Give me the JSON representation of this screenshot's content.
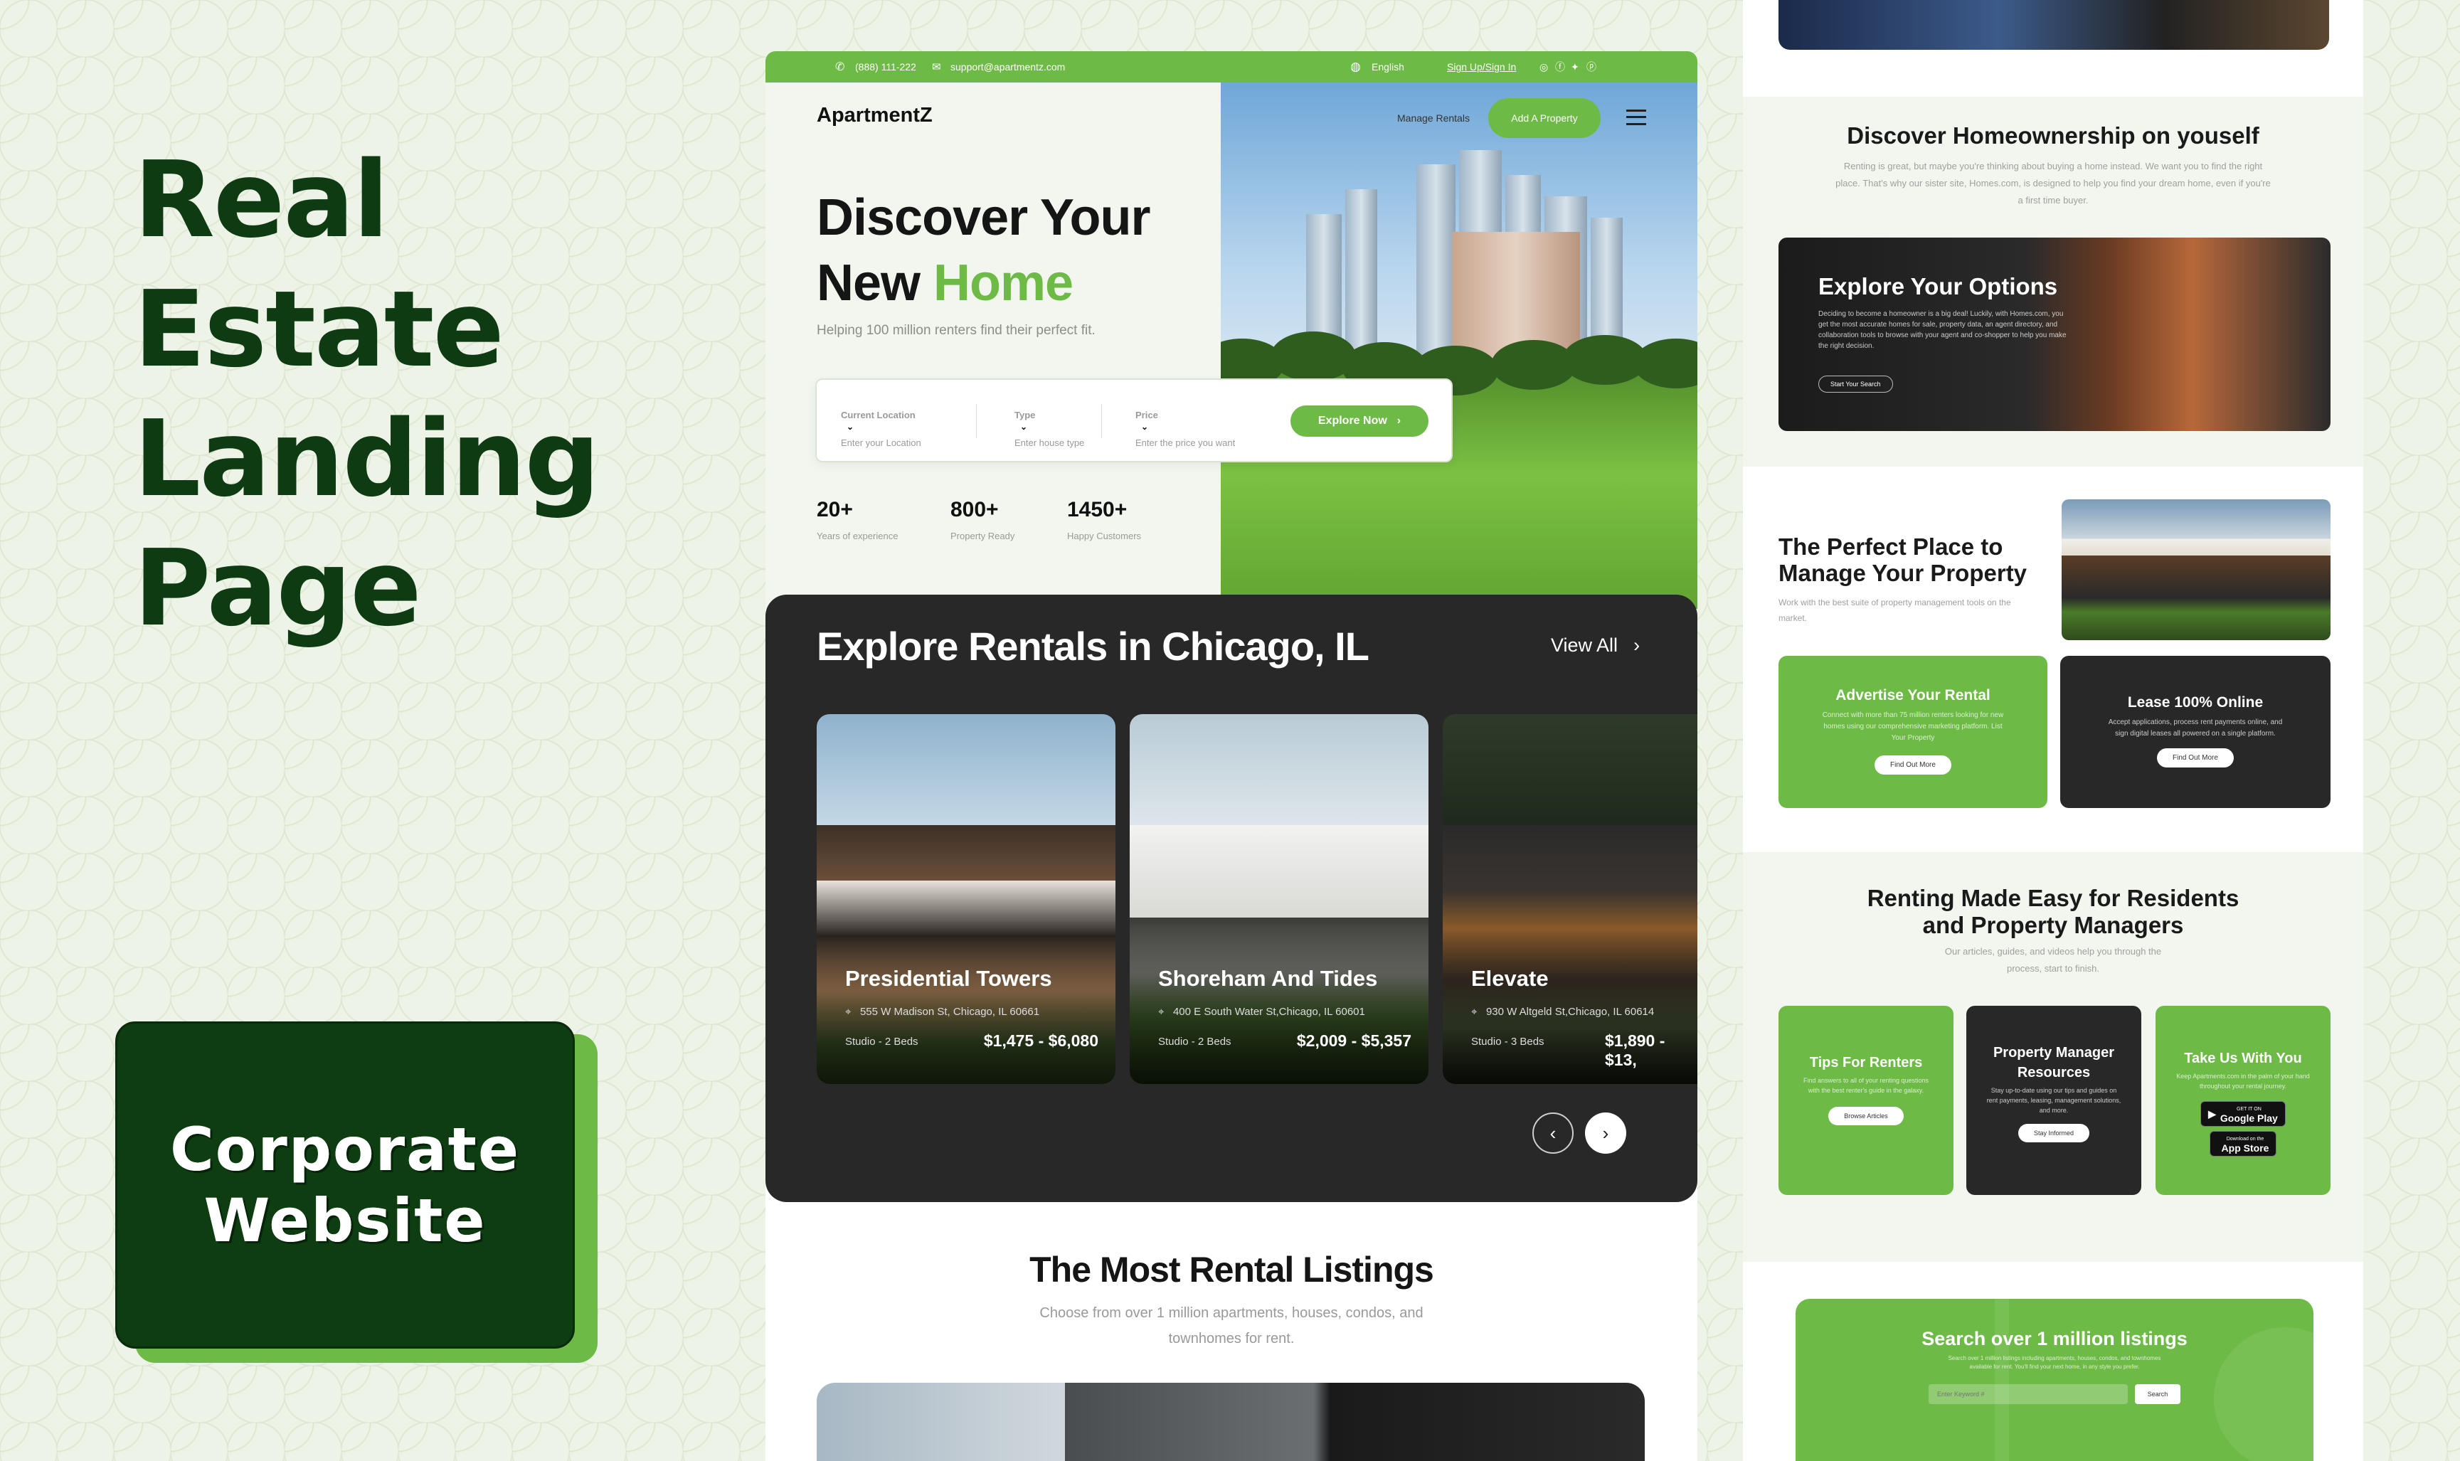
{
  "poster": {
    "title_lines": [
      "Real",
      "Estate",
      "Landing",
      "Page"
    ],
    "badge_lines": [
      "Corporate",
      "Website"
    ]
  },
  "topbar": {
    "phone": "(888) 111-222",
    "email": "support@apartmentz.com",
    "language": "English",
    "auth": "Sign Up/Sign In"
  },
  "nav": {
    "brand": "ApartmentZ",
    "manage": "Manage Rentals",
    "add": "Add A Property"
  },
  "hero": {
    "title_line1": "Discover Your",
    "title_line2_a": "New ",
    "title_line2_b": "Home",
    "subtitle": "Helping 100 million renters find their perfect fit.",
    "search": [
      {
        "label": "Current Location",
        "hint": "Enter your Location"
      },
      {
        "label": "Type",
        "hint": "Enter house type"
      },
      {
        "label": "Price",
        "hint": "Enter the price you want"
      }
    ],
    "cta": "Explore Now",
    "stats": [
      {
        "value": "20+",
        "label": "Years of experience"
      },
      {
        "value": "800+",
        "label": "Property Ready"
      },
      {
        "value": "1450+",
        "label": "Happy Customers"
      }
    ]
  },
  "rentals": {
    "title": "Explore Rentals in Chicago, IL",
    "view_all": "View All",
    "items": [
      {
        "name": "Presidential Towers",
        "address": "555 W Madison St, Chicago, IL 60661",
        "beds": "Studio - 2 Beds",
        "price": "$1,475 - $6,080"
      },
      {
        "name": "Shoreham And Tides",
        "address": "400 E South Water St,Chicago, IL 60601",
        "beds": "Studio - 2 Beds",
        "price": "$2,009 - $5,357"
      },
      {
        "name": "Elevate",
        "address": "930 W Altgeld St,Chicago, IL 60614",
        "beds": "Studio - 3 Beds",
        "price": "$1,890 - $13,"
      }
    ]
  },
  "listings": {
    "title": "The Most Rental Listings",
    "subtitle_line1": "Choose from over 1 million apartments, houses, condos, and",
    "subtitle_line2": "townhomes for rent."
  },
  "right": {
    "homeownership": {
      "title": "Discover Homeownership on youself",
      "text": "Renting is great, but maybe you're thinking about buying a home instead. We want you to find the right place. That's why our sister site, Homes.com, is designed to help you find your dream home, even if you're a first time buyer."
    },
    "options": {
      "title": "Explore Your Options",
      "text": "Deciding to become a homeowner is a big deal! Luckily, with Homes.com, you get the most accurate homes for sale, property data, an agent directory, and collaboration tools to browse with your agent and co-shopper to help you make the right decision.",
      "button": "Start Your Search"
    },
    "manage": {
      "title_line1": "The Perfect Place to",
      "title_line2": "Manage Your Property",
      "text": "Work with the best suite of property management tools on the market."
    },
    "advertise": {
      "title": "Advertise Your Rental",
      "text": "Connect with more than 75 million renters looking for new homes using our comprehensive marketing platform. List Your Property",
      "button": "Find Out More"
    },
    "lease": {
      "title": "Lease 100% Online",
      "text": "Accept applications, process rent payments online, and sign digital leases all powered on a single platform.",
      "button": "Find Out More"
    },
    "easy": {
      "title_line1": "Renting Made Easy for Residents",
      "title_line2": "and Property Managers",
      "text": "Our articles, guides, and videos help you through the process, start to finish."
    },
    "tiles": [
      {
        "title": "Tips For Renters",
        "text": "Find answers to all of your renting questions with the best renter's guide in the galaxy.",
        "button": "Browse Articles"
      },
      {
        "title": "Property Manager Resources",
        "text": "Stay up-to-date using our tips and guides on rent payments, leasing, management solutions, and more.",
        "button": "Stay Informed"
      },
      {
        "title": "Take Us With You",
        "text": "Keep Apartments.com in the palm of your hand throughout your rental journey.",
        "google_small": "GET IT ON",
        "google": "Google Play",
        "apple_small": "Download on the",
        "apple": "App Store"
      }
    ],
    "cta": {
      "title": "Search over 1 million listings",
      "text": "Search over 1 million listings including apartments, houses, condos, and townhomes available for rent. You'll find your next home, in any style you prefer.",
      "placeholder": "Enter Keyword #",
      "button": "Search"
    }
  },
  "colors": {
    "green": "#6dbb46",
    "dark_green": "#0d3d10",
    "dark": "#282828"
  }
}
